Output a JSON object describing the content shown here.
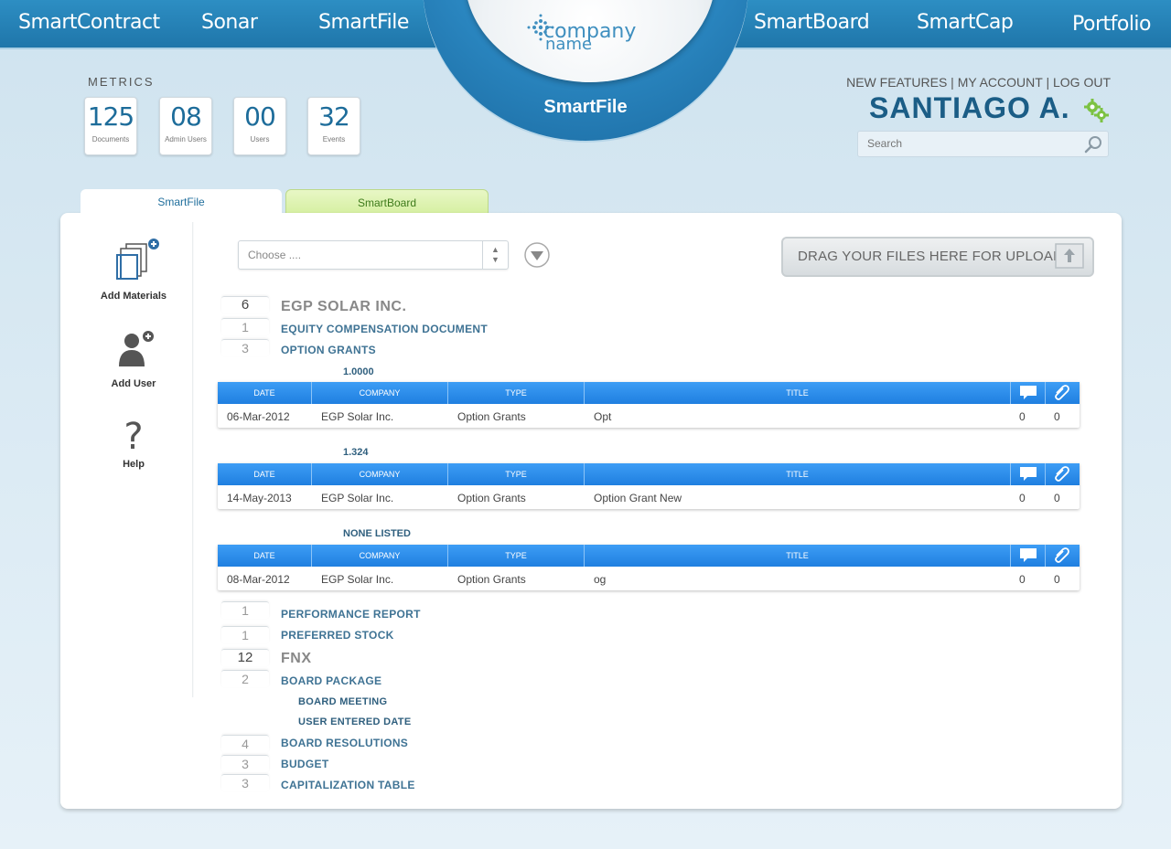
{
  "nav": {
    "left": [
      "SmartContract",
      "Sonar",
      "SmartFile"
    ],
    "right": [
      "SmartBoard",
      "SmartCap",
      "Portfolio"
    ]
  },
  "logo": {
    "line1": "company",
    "line2": "name",
    "caption": "SmartFile"
  },
  "metrics": {
    "title": "METRICS",
    "items": [
      {
        "value": "125",
        "label": "Documents"
      },
      {
        "value": "08",
        "label": "Admin Users"
      },
      {
        "value": "00",
        "label": "Users"
      },
      {
        "value": "32",
        "label": "Events"
      }
    ]
  },
  "account": {
    "links": [
      "NEW FEATURES",
      "MY ACCOUNT",
      "LOG OUT"
    ],
    "user": "SANTIAGO A.",
    "search_placeholder": "Search"
  },
  "tabs": [
    "SmartFile",
    "SmartBoard"
  ],
  "sidebar": [
    "Add Materials",
    "Add User",
    "Help"
  ],
  "toolbar": {
    "choose": "Choose ....",
    "upload": "DRAG YOUR FILES HERE FOR UPLOAD"
  },
  "tree": {
    "egp": {
      "count": "6",
      "name": "EGP SOLAR INC."
    },
    "equity": {
      "count": "1",
      "name": "EQUITY COMPENSATION DOCUMENT"
    },
    "option": {
      "count": "3",
      "name": "OPTION GRANTS"
    },
    "performance": {
      "count": "1",
      "name": "PERFORMANCE REPORT"
    },
    "preferred": {
      "count": "1",
      "name": "PREFERRED STOCK"
    },
    "fnx": {
      "count": "12",
      "name": "FNX"
    },
    "board_package": {
      "count": "2",
      "name": "BOARD PACKAGE"
    },
    "board_meeting": {
      "name": "BOARD MEETING"
    },
    "user_entered": {
      "name": "USER ENTERED DATE"
    },
    "board_resolutions": {
      "count": "4",
      "name": "BOARD RESOLUTIONS"
    },
    "budget": {
      "count": "3",
      "name": "BUDGET"
    },
    "cap_table": {
      "count": "3",
      "name": "CAPITALIZATION TABLE"
    }
  },
  "columns": [
    "DATE",
    "COMPANY",
    "TYPE",
    "TITLE"
  ],
  "grids": [
    {
      "version": "1.0000",
      "date": "06-Mar-2012",
      "company": "EGP Solar Inc.",
      "type": "Option Grants",
      "title": "Opt",
      "comments": "0",
      "attachments": "0"
    },
    {
      "version": "1.324",
      "date": "14-May-2013",
      "company": "EGP Solar Inc.",
      "type": "Option Grants",
      "title": "Option Grant New",
      "comments": "0",
      "attachments": "0"
    },
    {
      "version": "NONE LISTED",
      "date": "08-Mar-2012",
      "company": "EGP Solar Inc.",
      "type": "Option Grants",
      "title": "og",
      "comments": "0",
      "attachments": "0"
    }
  ],
  "colors": {
    "nav_blue": "#2d8ec3",
    "grid_header": "#2f8ef0",
    "accent_green": "#7cc243",
    "label_blue": "#3f7394"
  }
}
